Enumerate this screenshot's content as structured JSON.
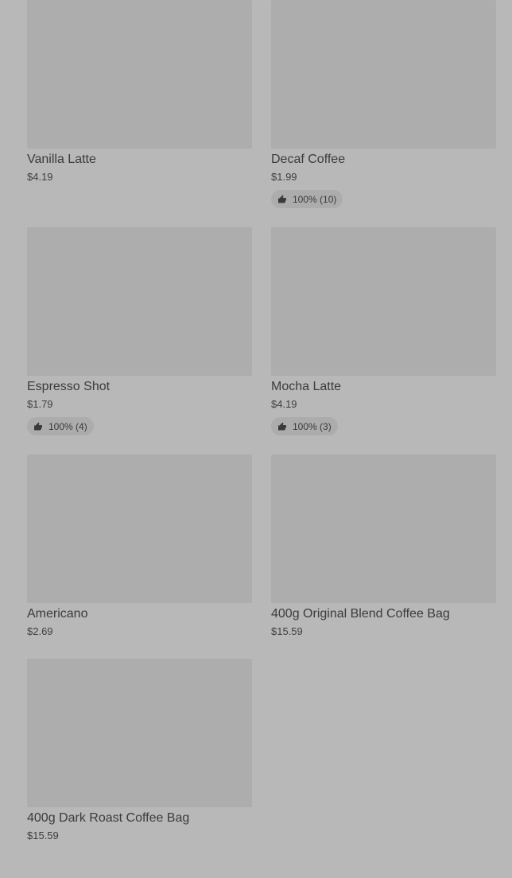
{
  "products": [
    {
      "name": "Vanilla Latte",
      "price": "$4.19"
    },
    {
      "name": "Decaf Coffee",
      "price": "$1.99",
      "rating": "100% (10)"
    },
    {
      "name": "Espresso Shot",
      "price": "$1.79",
      "rating": "100% (4)"
    },
    {
      "name": "Mocha Latte",
      "price": "$4.19",
      "rating": "100% (3)"
    },
    {
      "name": "Americano",
      "price": "$2.69"
    },
    {
      "name": "400g Original Blend Coffee Bag",
      "price": "$15.59"
    },
    {
      "name": "400g Dark Roast Coffee Bag",
      "price": "$15.59"
    }
  ],
  "colors": {
    "background": "#b8b8b8",
    "thumbnail": "#adadad",
    "text": "#3a3a3a"
  }
}
